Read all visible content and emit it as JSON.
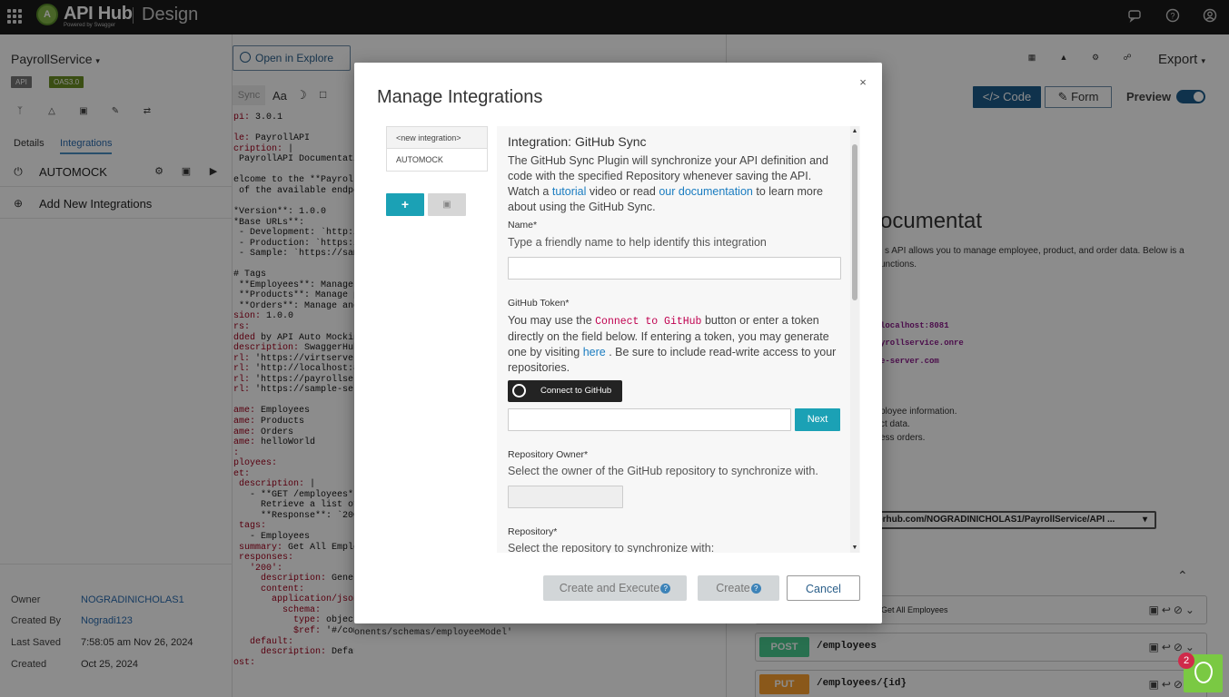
{
  "topbar": {
    "brand": "API Hub",
    "brand_sub": "Powered by Swagger",
    "logo_letter": "A",
    "product": "Design"
  },
  "sidebar": {
    "api_name": "PayrollService",
    "badges": [
      "API",
      "OAS3.0"
    ],
    "tabs": [
      "Details",
      "Integrations"
    ],
    "integrations": [
      {
        "label": "AUTOMOCK"
      },
      {
        "label": "Add New Integrations"
      }
    ],
    "meta": [
      {
        "label": "Owner",
        "value": "NOGRADINICHOLAS1"
      },
      {
        "label": "Created By",
        "value": "Nogradi123"
      },
      {
        "label": "Last Saved",
        "value": "7:58:05 am Nov 26, 2024"
      },
      {
        "label": "Created",
        "value": "Oct 25, 2024"
      }
    ]
  },
  "editor": {
    "open_explore": "Open in Explore",
    "sync_label": "Sync",
    "font_btn": "Aa",
    "lines": [
      {
        "k": "pi:",
        "v": " 3.0.1"
      },
      {
        "k": "",
        "v": ""
      },
      {
        "k": "le:",
        "v": " PayrollAPI"
      },
      {
        "k": "cription:",
        "v": " |"
      },
      {
        "k": "",
        "v": " PayrollAPI Documentatio"
      },
      {
        "k": "",
        "v": ""
      },
      {
        "k": "",
        "v": "elcome to the **PayrollA"
      },
      {
        "k": "",
        "v": " of the available endpoi"
      },
      {
        "k": "",
        "v": ""
      },
      {
        "k": "",
        "v": "*Version**: 1.0.0"
      },
      {
        "k": "",
        "v": "*Base URLs**:"
      },
      {
        "k": "",
        "v": " - Development: `http://"
      },
      {
        "k": "",
        "v": " - Production: `https://"
      },
      {
        "k": "",
        "v": " - Sample: `https://samp"
      },
      {
        "k": "",
        "v": ""
      },
      {
        "k": "",
        "v": "# Tags"
      },
      {
        "k": "",
        "v": " **Employees**: Manage e"
      },
      {
        "k": "",
        "v": " **Products**: Manage pr"
      },
      {
        "k": "",
        "v": " **Orders**: Manage and"
      },
      {
        "k": "sion:",
        "v": " 1.0.0"
      },
      {
        "k": "rs:",
        "v": ""
      },
      {
        "k": "dded",
        "v": " by API Auto Mocking"
      },
      {
        "k": "description:",
        "v": " SwaggerHub A"
      },
      {
        "k": "rl:",
        "v": " 'https://virtserver.s"
      },
      {
        "k": "rl:",
        "v": " 'http://localhost:80"
      },
      {
        "k": "rl:",
        "v": " 'https://payrollservi"
      },
      {
        "k": "rl:",
        "v": " 'https://sample-serve"
      },
      {
        "k": "",
        "v": ""
      },
      {
        "k": "ame:",
        "v": " Employees"
      },
      {
        "k": "ame:",
        "v": " Products"
      },
      {
        "k": "ame:",
        "v": " Orders"
      },
      {
        "k": "ame:",
        "v": " helloWorld"
      },
      {
        "k": ":",
        "v": ""
      },
      {
        "k": "ployees:",
        "v": ""
      },
      {
        "k": "et:",
        "v": ""
      },
      {
        "k": " description:",
        "v": " |"
      },
      {
        "k": "",
        "v": "   - **GET /employees**"
      },
      {
        "k": "",
        "v": "     Retrieve a list of e"
      },
      {
        "k": "",
        "v": "     **Response**: `200 O"
      },
      {
        "k": " tags:",
        "v": ""
      },
      {
        "k": "",
        "v": "   - Employees"
      },
      {
        "k": " summary:",
        "v": " Get All Employ"
      },
      {
        "k": " responses:",
        "v": ""
      },
      {
        "k": "   '200':",
        "v": ""
      },
      {
        "k": "     description:",
        "v": " Generat"
      },
      {
        "k": "     content:",
        "v": ""
      },
      {
        "k": "       application/json:",
        "v": ""
      },
      {
        "k": "         schema:",
        "v": ""
      },
      {
        "k": "           type:",
        "v": " object"
      },
      {
        "k": "           $ref:",
        "v": " '#/comp"
      },
      {
        "k": "   default:",
        "v": ""
      },
      {
        "k": "     description:",
        "v": " Default"
      },
      {
        "k": "ost:",
        "v": ""
      }
    ],
    "ref_tail": "onents/schemas/employeeModel'"
  },
  "preview": {
    "export_label": "Export",
    "code_btn": "Code",
    "form_btn": "Form",
    "preview_label": "Preview",
    "doc_title": "ocumentat",
    "doc_intro_1": "s API allows you to manage employee, product, and order data. Below is a",
    "doc_intro_2": "unctions.",
    "urls": [
      "localhost:8081",
      "yrollservice.onre",
      "e-server.com"
    ],
    "tags_desc": [
      "ployee information.",
      "ct data.",
      "ess orders."
    ],
    "server_select": "gerhub.com/NOGRADINICHOLAS1/PayrollService/API ...",
    "get_summary": "Get All Employees",
    "operations": [
      {
        "method": "POST",
        "path": "/employees",
        "color": "#49cc90"
      },
      {
        "method": "PUT",
        "path": "/employees/{id}",
        "color": "#fca130"
      }
    ]
  },
  "modal": {
    "title": "Manage Integrations",
    "list": [
      "<new integration>",
      "AUTOMOCK"
    ],
    "add_btn": "+",
    "form": {
      "heading": "Integration: GitHub Sync",
      "desc_1": "The GitHub Sync Plugin will synchronize your API definition and code with the specified Repository whenever saving the API. Watch a",
      "desc_link1": "tutorial",
      "desc_2": " video or read ",
      "desc_link2": "our documentation",
      "desc_3": " to learn more about using the GitHub Sync.",
      "name_label": "Name*",
      "name_help": "Type a friendly name to help identify this integration",
      "token_label": "GitHub Token*",
      "token_help_1": "You may use the ",
      "token_code": "Connect to GitHub",
      "token_help_2": " button or enter a token directly on the field below. If entering a token, you may generate one by visiting ",
      "token_link": "here",
      "token_help_3": " . Be sure to include read-write access to your repositories.",
      "connect_btn": "Connect to GitHub",
      "next_btn": "Next",
      "owner_label": "Repository Owner*",
      "owner_help": "Select the owner of the GitHub repository to synchronize with.",
      "repo_label": "Repository*",
      "repo_help": "Select the repository to synchronize with:"
    },
    "buttons": {
      "create_execute": "Create and Execute",
      "create": "Create",
      "cancel": "Cancel"
    }
  },
  "chat": {
    "badge": "2"
  },
  "colors": {
    "accent": "#1ba1b5",
    "primary": "#1c5b8a",
    "topbar": "#1b1b1b",
    "badge_api": "#777777",
    "badge_oas": "#6b8e23"
  }
}
